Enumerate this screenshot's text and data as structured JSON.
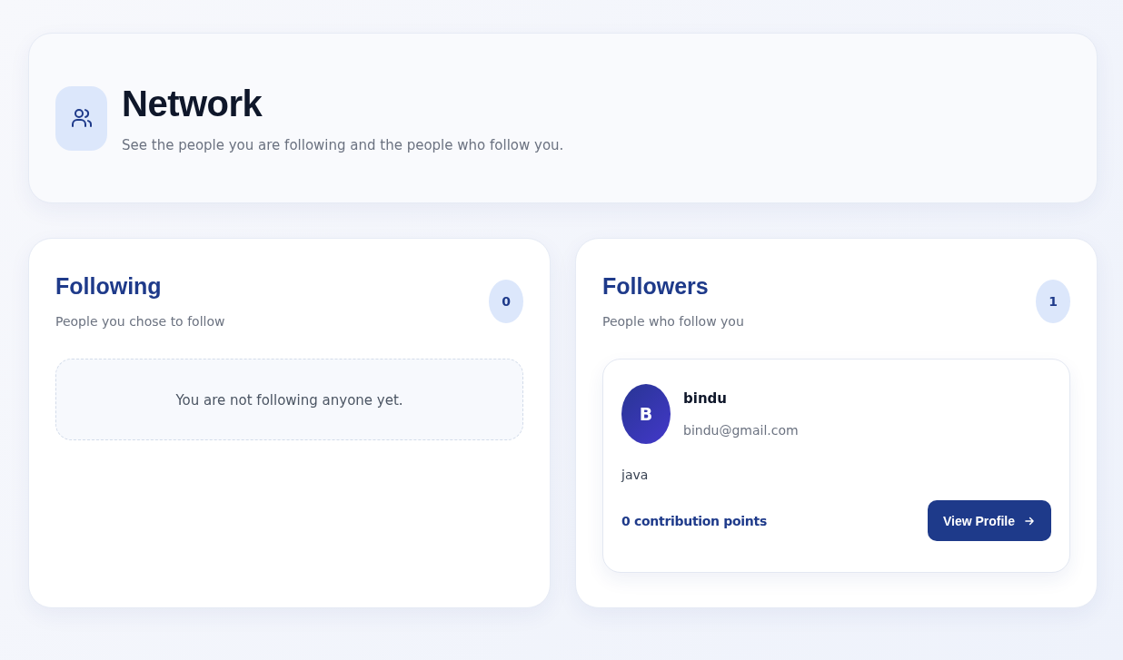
{
  "header": {
    "title": "Network",
    "subtitle": "See the people you are following and the people who follow you."
  },
  "panels": [
    {
      "title": "Following",
      "subtitle": "People you chose to follow",
      "count": "0",
      "empty_message": "You are not following anyone yet."
    },
    {
      "title": "Followers",
      "subtitle": "People who follow you",
      "count": "1",
      "people": [
        {
          "initial": "B",
          "name": "bindu",
          "email": "bindu@gmail.com",
          "bio": "java",
          "points": "0 contribution points",
          "button": "View Profile"
        }
      ]
    }
  ]
}
